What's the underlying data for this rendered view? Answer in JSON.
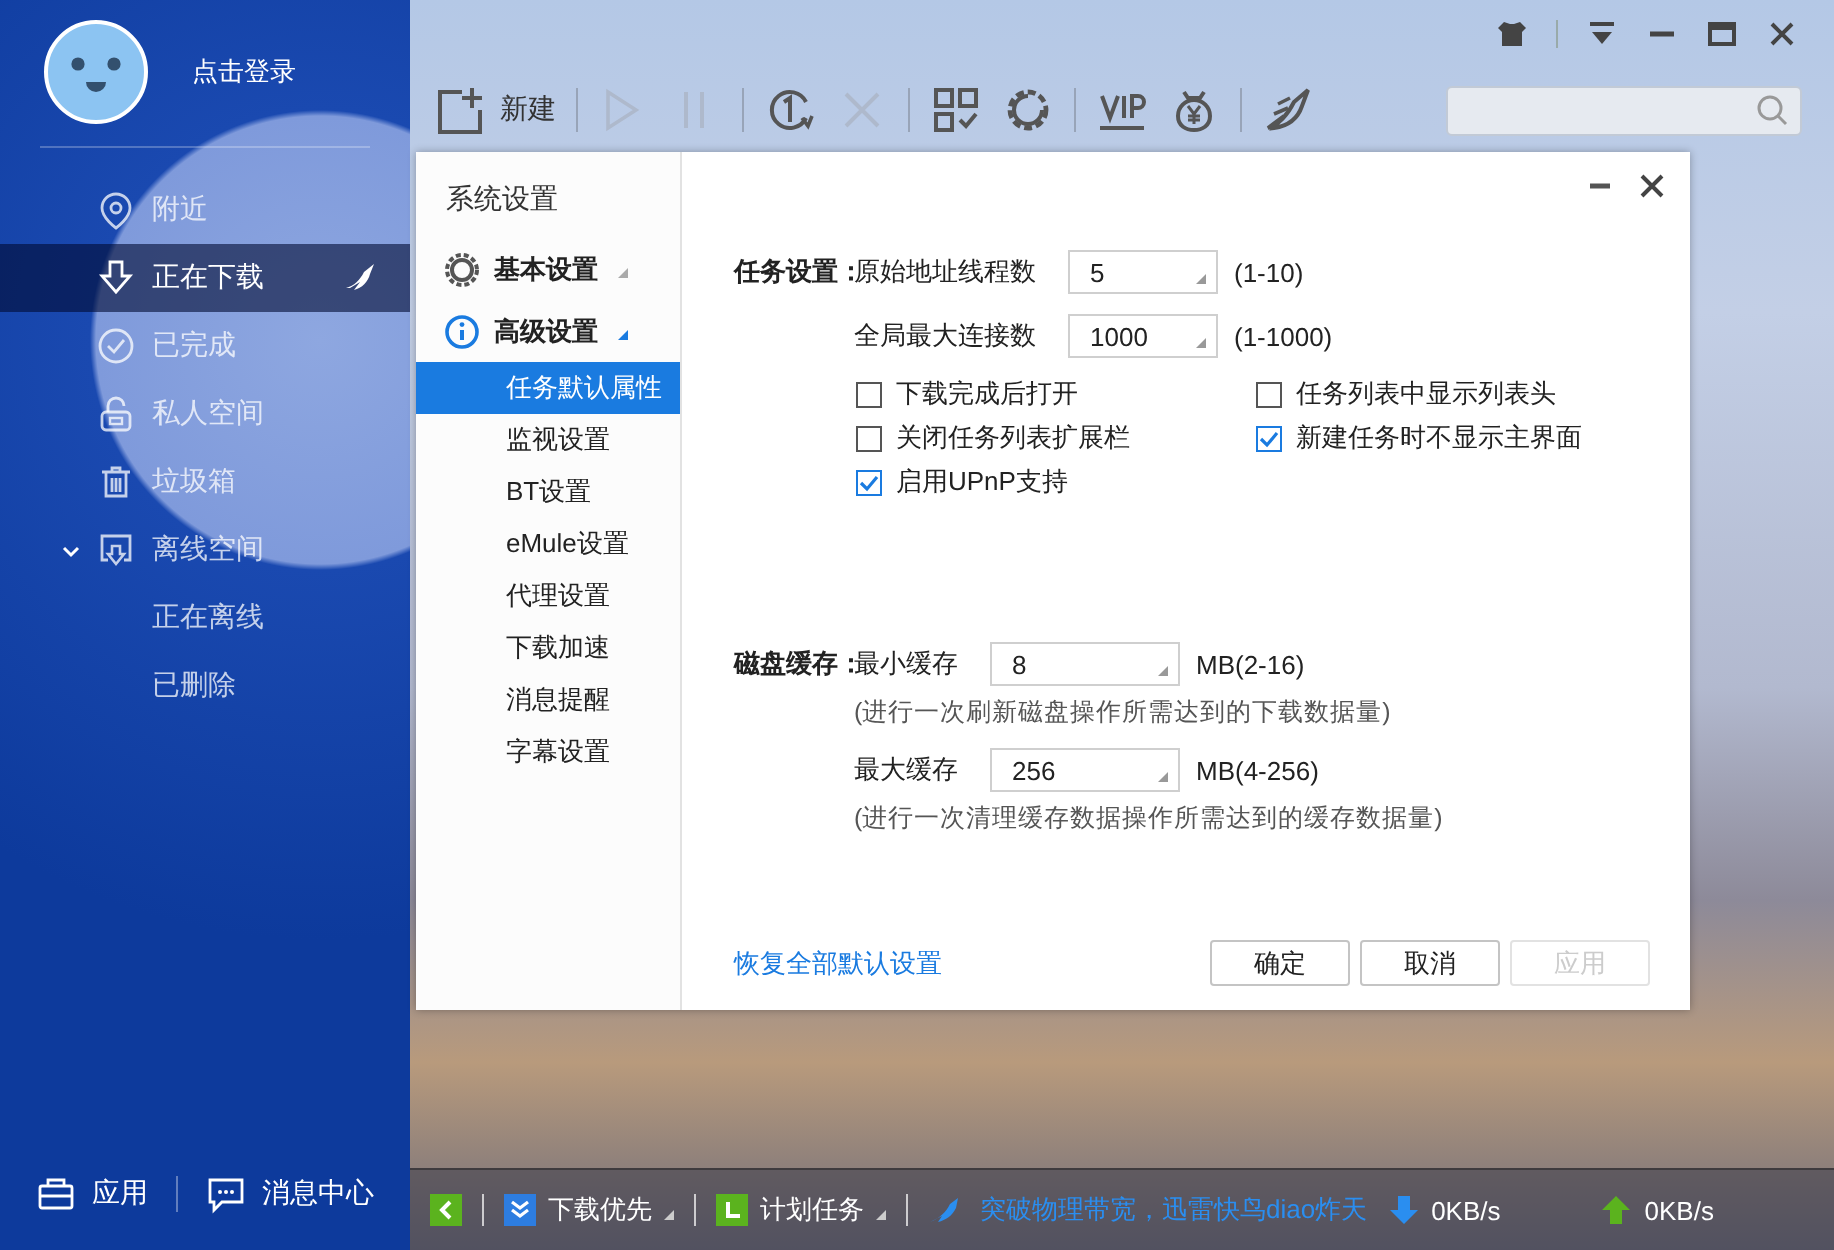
{
  "sidebar": {
    "login": "点击登录",
    "items": [
      {
        "label": "附近",
        "kind": "pin",
        "selected": false
      },
      {
        "label": "正在下载",
        "kind": "download",
        "selected": true
      },
      {
        "label": "已完成",
        "kind": "done",
        "selected": false
      },
      {
        "label": "私人空间",
        "kind": "lock",
        "selected": false
      },
      {
        "label": "垃圾箱",
        "kind": "trash",
        "selected": false
      },
      {
        "label": "离线空间",
        "kind": "offline",
        "selected": false,
        "expanded": true,
        "children": [
          {
            "label": "正在离线",
            "selected": false
          },
          {
            "label": "已删除",
            "selected": false
          }
        ]
      }
    ],
    "footer": [
      {
        "label": "应用",
        "kind": "app"
      },
      {
        "label": "消息中心",
        "kind": "message"
      }
    ]
  },
  "toolbar": {
    "new_label": "新建",
    "tools": [
      {
        "kind": "play",
        "disabled": true
      },
      {
        "kind": "pause",
        "disabled": true
      },
      {
        "kind": "one",
        "disabled": false
      },
      {
        "kind": "delete",
        "disabled": true
      },
      {
        "kind": "qr",
        "disabled": false
      },
      {
        "kind": "speed",
        "disabled": false
      },
      {
        "kind": "vip",
        "disabled": false
      },
      {
        "kind": "money",
        "disabled": false
      },
      {
        "kind": "bird",
        "disabled": false
      }
    ]
  },
  "dialog": {
    "title": "系统设置",
    "nav": [
      {
        "label": "基本设置",
        "kind": "group",
        "selected": false
      },
      {
        "label": "高级设置",
        "kind": "group",
        "selected": false
      },
      {
        "label": "任务默认属性",
        "kind": "item",
        "selected": true
      },
      {
        "label": "监视设置",
        "kind": "item",
        "selected": false
      },
      {
        "label": "BT设置",
        "kind": "item",
        "selected": false
      },
      {
        "label": "eMule设置",
        "kind": "item",
        "selected": false
      },
      {
        "label": "代理设置",
        "kind": "item",
        "selected": false
      },
      {
        "label": "下载加速",
        "kind": "item",
        "selected": false
      },
      {
        "label": "消息提醒",
        "kind": "item",
        "selected": false
      },
      {
        "label": "字幕设置",
        "kind": "item",
        "selected": false
      }
    ],
    "task": {
      "heading": "任务设置：",
      "fields": [
        {
          "label": "原始地址线程数",
          "value": "5",
          "range": "(1-10)"
        },
        {
          "label": "全局最大连接数",
          "value": "1000",
          "range": "(1-1000)"
        }
      ],
      "checkboxes": [
        {
          "label": "下载完成后打开",
          "checked": false
        },
        {
          "label": "任务列表中显示列表头",
          "checked": false
        },
        {
          "label": "关闭任务列表扩展栏",
          "checked": false
        },
        {
          "label": "新建任务时不显示主界面",
          "checked": true
        },
        {
          "label": "启用UPnP支持",
          "checked": true
        }
      ]
    },
    "disk": {
      "heading": "磁盘缓存：",
      "fields": [
        {
          "label": "最小缓存",
          "value": "8",
          "range": "MB(2-16)",
          "note": "(进行一次刷新磁盘操作所需达到的下载数据量)"
        },
        {
          "label": "最大缓存",
          "value": "256",
          "range": "MB(4-256)",
          "note": "(进行一次清理缓存数据操作所需达到的缓存数据量)"
        }
      ]
    },
    "restore_link": "恢复全部默认设置",
    "buttons": [
      {
        "label": "确定",
        "disabled": false
      },
      {
        "label": "取消",
        "disabled": false
      },
      {
        "label": "应用",
        "disabled": true
      }
    ]
  },
  "status_bar": {
    "priority": "下载优先",
    "schedule": "计划任务",
    "promo": "突破物理带宽，迅雷快鸟diao炸天",
    "download_speed": "0KB/s",
    "upload_speed": "0KB/s"
  }
}
